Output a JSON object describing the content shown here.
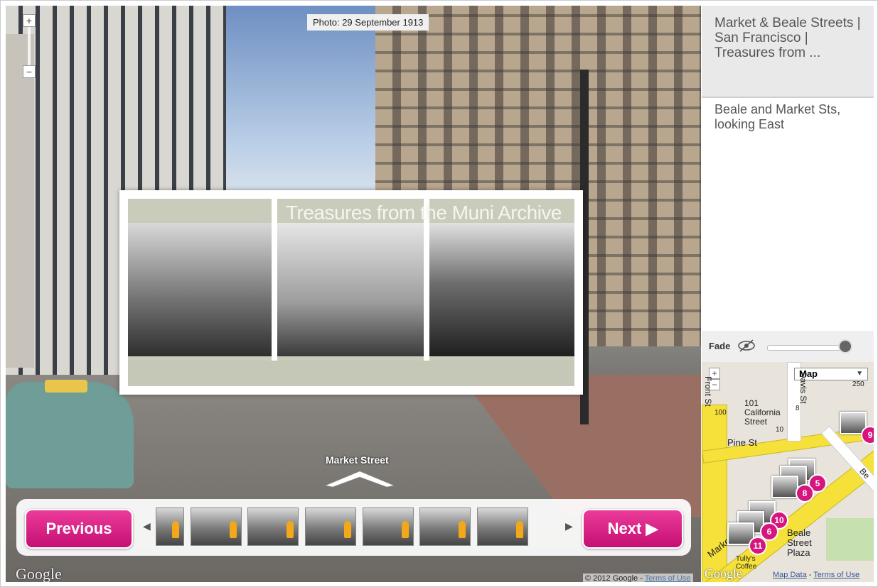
{
  "photo_date": "Photo: 29 September 1913",
  "overlay": {
    "title": "Treasures from the Muni Archive"
  },
  "street_label": "Market Street",
  "filmstrip": {
    "previous_label": "Previous",
    "next_label": "Next ▶",
    "thumbnail_count": 7
  },
  "footer": {
    "google_logo": "Google",
    "copyright": "© 2012 Google - ",
    "terms": "Terms of Use"
  },
  "panel": {
    "title": "Market & Beale Streets | San Francisco | Treasures from ...",
    "description": "Beale and Market Sts, looking East",
    "fade_label": "Fade"
  },
  "map": {
    "type_selected": "Map",
    "labels": {
      "building": "101 California Street",
      "pine": "Pine St",
      "front": "Front St",
      "market": "Market St",
      "beale_plaza": "Beale Street Plaza",
      "tullys": "Tully's Coffee",
      "num_100": "100",
      "num_10": "10",
      "num_8": "8",
      "num_250": "250",
      "davis": "Davis St",
      "beale": "Be"
    },
    "pins": [
      "9",
      "5",
      "8",
      "10",
      "6",
      "11"
    ],
    "google_logo": "Google",
    "map_data": "Map Data",
    "terms": "Terms of Use"
  },
  "colors": {
    "accent": "#d6157f",
    "panel_bg": "#e9e9e9"
  }
}
